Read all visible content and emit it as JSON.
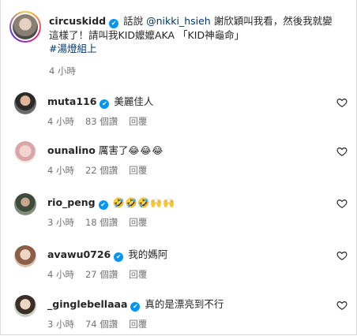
{
  "post": {
    "username": "circuskidd",
    "caption_prefix": "話說",
    "mention": "@nikki_hsieh",
    "caption_rest": "謝欣穎叫我看，然後我就變這樣了！請叫我KID嬤嬤AKA 「KID神龜命」",
    "hashtag": "#湯燈組上",
    "time": "4 小時"
  },
  "comments": [
    {
      "username": "muta116",
      "text": "美麗佳人",
      "emoji": "",
      "time": "4 小時",
      "likes": "83 個讚",
      "reply": "回覆"
    },
    {
      "username": "ounalino",
      "text": "厲害了",
      "emoji": "😂😂😂",
      "time": "4 小時",
      "likes": "22 個讚",
      "reply": "回覆"
    },
    {
      "username": "rio_peng",
      "text": "",
      "emoji": "🤣🤣🤣🙌🙌",
      "time": "3 小時",
      "likes": "18 個讚",
      "reply": "回覆"
    },
    {
      "username": "avawu0726",
      "text": "我的媽阿",
      "emoji": "",
      "time": "4 小時",
      "likes": "27 個讚",
      "reply": "回覆"
    },
    {
      "username": "_ginglebellaaa",
      "text": "真的是漂亮到不行",
      "emoji": "",
      "time": "3 小時",
      "likes": "74 個讚",
      "reply": "回覆"
    }
  ],
  "icons": {
    "verified": "verified-badge-icon",
    "heart": "heart-outline-icon"
  },
  "colors": {
    "verified": "#0095f6",
    "link": "#00376b",
    "meta": "#737373"
  }
}
